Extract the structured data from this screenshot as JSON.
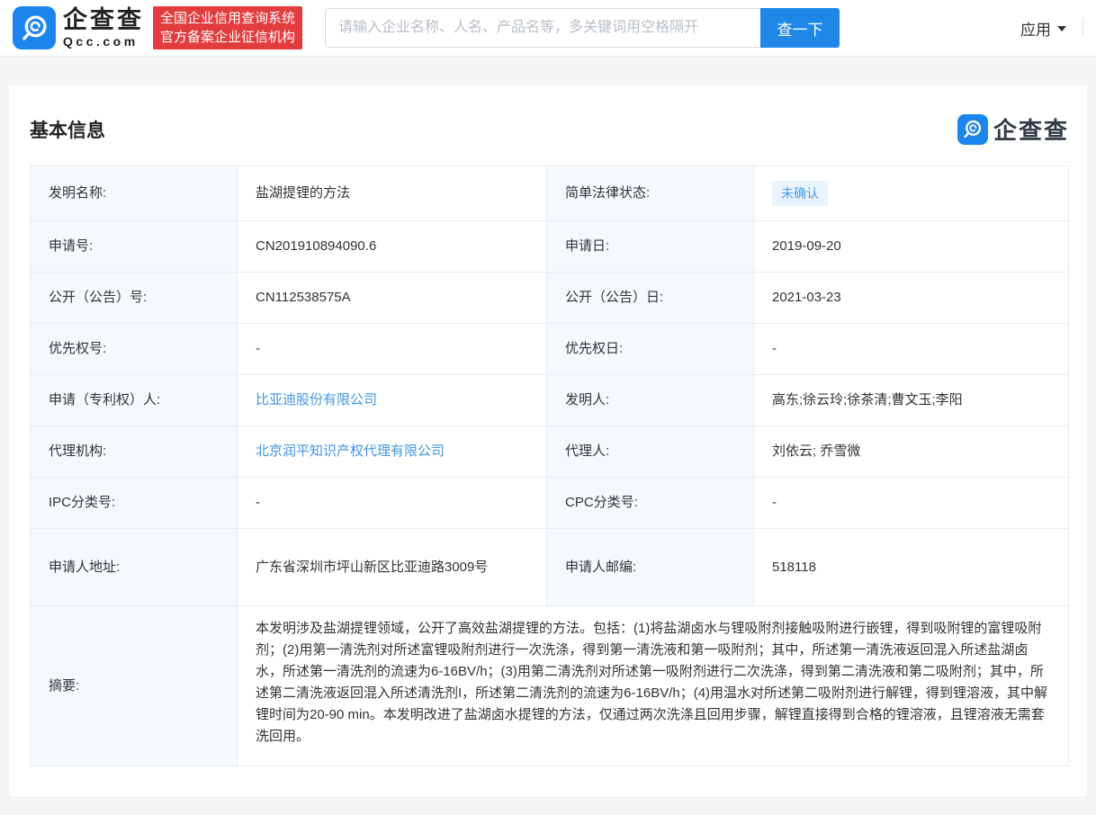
{
  "header": {
    "logo": {
      "brand": "企查查",
      "domain": "Qcc.com"
    },
    "cert_badge": {
      "line1": "全国企业信用查询系统",
      "line2": "官方备案企业征信机构"
    },
    "search": {
      "placeholder": "请输入企业名称、人名、产品名等，多关键词用空格隔开",
      "button_label": "查一下"
    },
    "apps_menu_label": "应用"
  },
  "colors": {
    "brand_blue": "#1d86ee",
    "button_blue": "#1e87e8",
    "brand_red": "#e23c3c",
    "link_blue": "#4295e5",
    "badge_bg": "#e8f3fd",
    "badge_text": "#4a9bea",
    "label_cell_bg": "#f3f9fc",
    "table_border": "#e6edf3"
  },
  "basic_info": {
    "section_title": "基本信息",
    "watermark_brand": "企查查",
    "rows": [
      {
        "label1": "发明名称:",
        "value1": "盐湖提锂的方法",
        "label2": "简单法律状态:",
        "value2": "未确认"
      },
      {
        "label1": "申请号:",
        "value1": "CN201910894090.6",
        "label2": "申请日:",
        "value2": "2019-09-20"
      },
      {
        "label1": "公开（公告）号:",
        "value1": "CN112538575A",
        "label2": "公开（公告）日:",
        "value2": "2021-03-23"
      },
      {
        "label1": "优先权号:",
        "value1": "-",
        "label2": "优先权日:",
        "value2": "-"
      },
      {
        "label1": "申请（专利权）人:",
        "value1": "比亚迪股份有限公司",
        "label2": "发明人:",
        "value2": "高东;徐云玲;徐茶清;曹文玉;李阳"
      },
      {
        "label1": "代理机构:",
        "value1": "北京润平知识产权代理有限公司",
        "label2": "代理人:",
        "value2": "刘依云; 乔雪微"
      },
      {
        "label1": "IPC分类号:",
        "value1": "-",
        "label2": "CPC分类号:",
        "value2": "-"
      },
      {
        "label1": "申请人地址:",
        "value1": "广东省深圳市坪山新区比亚迪路3009号",
        "label2": "申请人邮编:",
        "value2": "518118"
      },
      {
        "label1": "摘要:",
        "value1": "本发明涉及盐湖提锂领域，公开了高效盐湖提锂的方法。包括：(1)将盐湖卤水与锂吸附剂接触吸附进行嵌锂，得到吸附锂的富锂吸附剂；(2)用第一清洗剂对所述富锂吸附剂进行一次洗涤，得到第一清洗液和第一吸附剂；其中，所述第一清洗液返回混入所述盐湖卤水，所述第一清洗剂的流速为6-16BV/h；(3)用第二清洗剂对所述第一吸附剂进行二次洗涤，得到第二清洗液和第二吸附剂；其中，所述第二清洗液返回混入所述清洗剂I，所述第二清洗剂的流速为6-16BV/h；(4)用温水对所述第二吸附剂进行解锂，得到锂溶液，其中解锂时间为20-90 min。本发明改进了盐湖卤水提锂的方法，仅通过两次洗涤且回用步骤，解锂直接得到合格的锂溶液，且锂溶液无需套洗回用。"
      }
    ]
  }
}
